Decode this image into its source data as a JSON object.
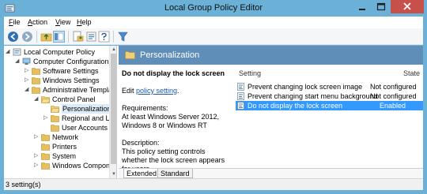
{
  "window": {
    "title": "Local Group Policy Editor",
    "colors": {
      "frame": "#6ab0d7",
      "close": "#c7514a",
      "header_band": "#5f8eb9",
      "selection": "#3399ff"
    }
  },
  "menu": [
    {
      "label": "File",
      "accel": "F"
    },
    {
      "label": "Action",
      "accel": "A"
    },
    {
      "label": "View",
      "accel": "V"
    },
    {
      "label": "Help",
      "accel": "H"
    }
  ],
  "toolbar": {
    "icons": [
      "back-icon",
      "forward-icon",
      "up-folder-icon",
      "show-hide-tree-icon",
      "export-list-icon",
      "properties-icon",
      "help-icon",
      "filter-icon"
    ]
  },
  "tree": [
    {
      "label": "Local Computer Policy",
      "level": 0,
      "icon": "policy-icon",
      "expanded": true
    },
    {
      "label": "Computer Configuration",
      "level": 1,
      "icon": "computer-icon",
      "expanded": true
    },
    {
      "label": "Software Settings",
      "level": 2,
      "icon": "folder-icon",
      "expanded": false
    },
    {
      "label": "Windows Settings",
      "level": 2,
      "icon": "folder-icon",
      "expanded": false
    },
    {
      "label": "Administrative Templates",
      "level": 2,
      "icon": "folder-icon",
      "expanded": true
    },
    {
      "label": "Control Panel",
      "level": 3,
      "icon": "folder-open-icon",
      "expanded": true
    },
    {
      "label": "Personalization",
      "level": 4,
      "icon": "folder-open-icon",
      "expanded": null,
      "selected": true
    },
    {
      "label": "Regional and Language Options",
      "level": 4,
      "icon": "folder-icon",
      "expanded": false
    },
    {
      "label": "User Accounts",
      "level": 4,
      "icon": "folder-icon",
      "expanded": null
    },
    {
      "label": "Network",
      "level": 3,
      "icon": "folder-icon",
      "expanded": false
    },
    {
      "label": "Printers",
      "level": 3,
      "icon": "folder-icon",
      "expanded": null
    },
    {
      "label": "System",
      "level": 3,
      "icon": "folder-icon",
      "expanded": false
    },
    {
      "label": "Windows Components",
      "level": 3,
      "icon": "folder-icon",
      "expanded": false
    }
  ],
  "pane": {
    "header": "Personalization",
    "description": {
      "title": "Do not display the lock screen",
      "edit_prefix": "Edit ",
      "edit_link": "policy setting",
      "edit_suffix": ".",
      "requirements_label": "Requirements:",
      "requirements_text": "At least Windows Server 2012, Windows 8 or Windows RT",
      "description_label": "Description:",
      "description_text": "This policy setting controls whether the lock screen appears for users."
    },
    "columns": {
      "setting": "Setting",
      "state": "State"
    },
    "settings": [
      {
        "name": "Prevent changing lock screen image",
        "state": "Not configured",
        "selected": false
      },
      {
        "name": "Prevent changing start menu background",
        "state": "Not configured",
        "selected": false
      },
      {
        "name": "Do not display the lock screen",
        "state": "Enabled",
        "selected": true
      }
    ],
    "tabs": [
      {
        "label": "Extended",
        "active": true
      },
      {
        "label": "Standard",
        "active": false
      }
    ]
  },
  "status": {
    "text": "3 setting(s)"
  }
}
